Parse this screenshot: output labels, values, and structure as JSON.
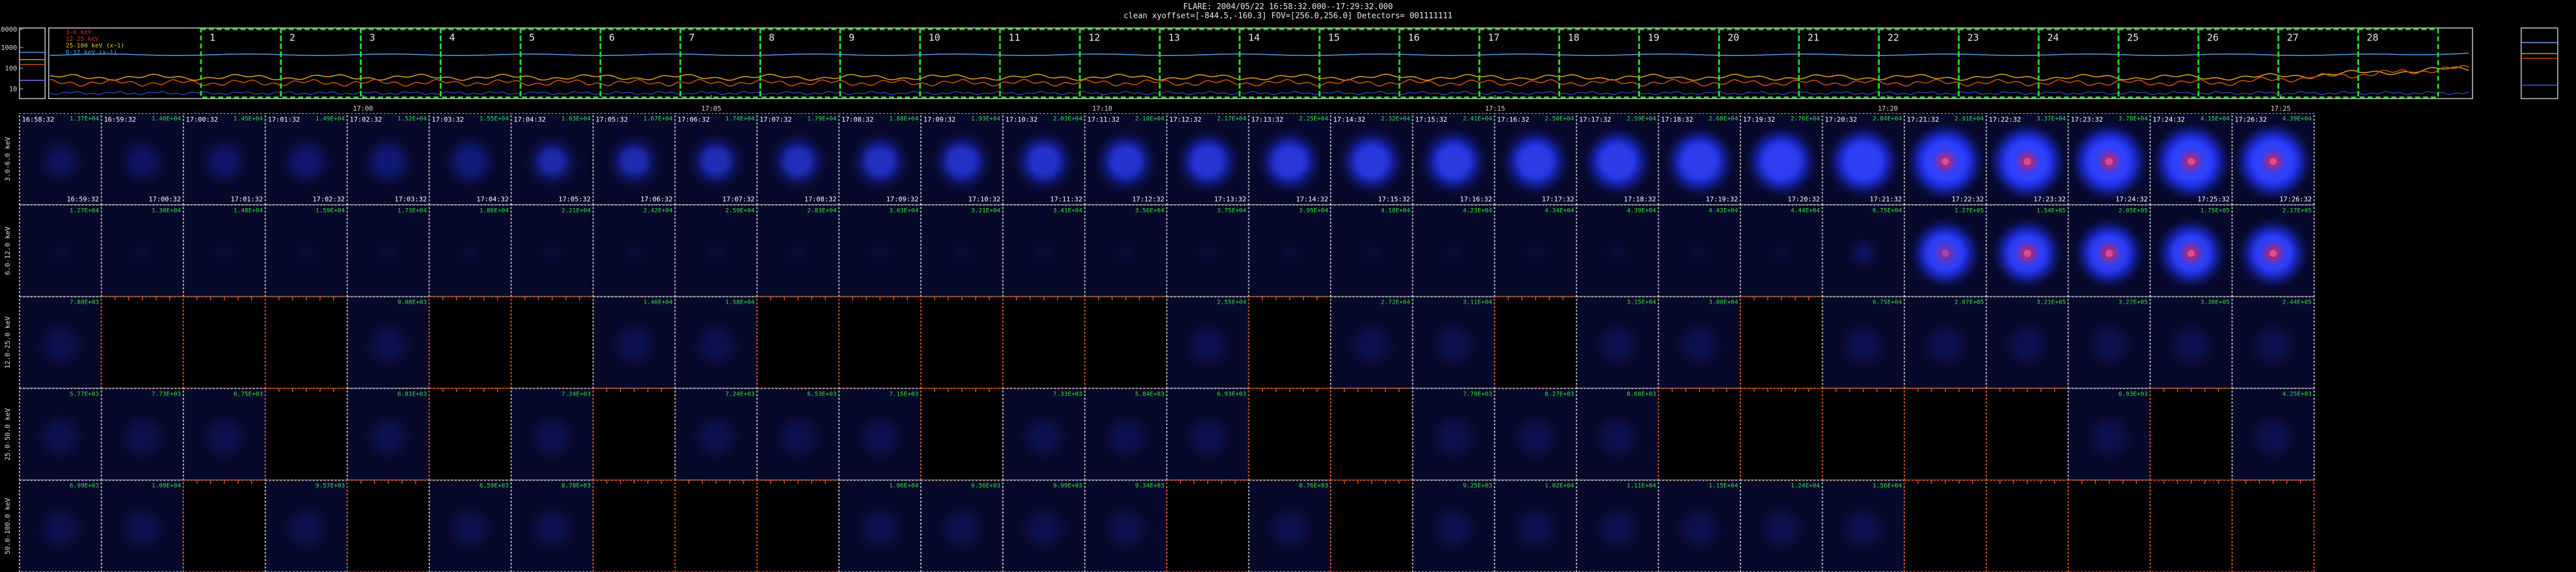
{
  "header": {
    "line1": "FLARE: 2004/05/22  16:58:32.000--17:29:32.000",
    "line2": "clean    xyoffset=[-844.5,-160.3]    FOV=[256.0,256.0]    Detectors= 001111111"
  },
  "timeline": {
    "yticks": [
      "10000",
      "1000",
      "100",
      "10"
    ],
    "legend": [
      "3-6 keV",
      "12-25 keV",
      "25-100 keV (x~1)",
      "6-12 keV (x~1)"
    ],
    "box_numbers": [
      "1",
      "2",
      "3",
      "4",
      "5",
      "6",
      "7",
      "8",
      "9",
      "10",
      "11",
      "12",
      "13",
      "14",
      "15",
      "16",
      "17",
      "18",
      "19",
      "20",
      "21",
      "22",
      "23",
      "24",
      "25",
      "26",
      "27",
      "28"
    ],
    "time_ticks": [
      "17:00",
      "17:05",
      "17:10",
      "17:15",
      "17:20",
      "17:25"
    ],
    "colors": {
      "series_a": "#4f9ce6",
      "series_b": "#e0a020",
      "series_c": "#d05010",
      "selection_boxes": "#28d828",
      "axes": "#cfcfcf"
    }
  },
  "grid": {
    "energy_bands": [
      "3.0-6.0 keV",
      "6.0-12.0 keV",
      "12.0-25.0 keV",
      "25.0-50.0 keV",
      "50.0-100.0 keV"
    ],
    "start_times": [
      "16:58:32",
      "16:59:32",
      "17:00:32",
      "17:01:32",
      "17:02:32",
      "17:03:32",
      "17:04:32",
      "17:05:32",
      "17:06:32",
      "17:07:32",
      "17:08:32",
      "17:09:32",
      "17:10:32",
      "17:11:32",
      "17:12:32",
      "17:13:32",
      "17:14:32",
      "17:15:32",
      "17:16:32",
      "17:17:32",
      "17:18:32",
      "17:19:32",
      "17:20:32",
      "17:21:32",
      "17:22:32",
      "17:23:32",
      "17:24:32",
      "17:26:32"
    ],
    "end_times": [
      "16:59:32",
      "17:00:32",
      "17:01:32",
      "17:02:32",
      "17:03:32",
      "17:04:32",
      "17:05:32",
      "17:06:32",
      "17:07:32",
      "17:08:32",
      "17:09:32",
      "17:10:32",
      "17:11:32",
      "17:12:32",
      "17:13:32",
      "17:14:32",
      "17:15:32",
      "17:16:32",
      "17:17:32",
      "17:18:32",
      "17:19:32",
      "17:20:32",
      "17:21:32",
      "17:22:32",
      "17:23:32",
      "17:24:32",
      "17:25:32",
      "17:26:32"
    ],
    "values": [
      [
        "1.37E+04",
        "1.40E+04",
        "1.45E+04",
        "1.49E+04",
        "1.52E+04",
        "1.55E+04",
        "1.63E+04",
        "1.67E+04",
        "1.74E+04",
        "1.79E+04",
        "1.88E+04",
        "1.93E+04",
        "2.03E+04",
        "2.10E+04",
        "2.17E+04",
        "2.25E+04",
        "2.32E+04",
        "2.41E+04",
        "2.50E+04",
        "2.59E+04",
        "2.68E+04",
        "2.76E+04",
        "2.84E+04",
        "2.91E+04",
        "3.37E+04",
        "3.78E+04",
        "4.15E+04",
        "4.39E+04"
      ],
      [
        "1.27E+04",
        "1.30E+04",
        "1.48E+04",
        "1.59E+04",
        "1.73E+04",
        "1.86E+04",
        "2.21E+04",
        "2.42E+04",
        "2.59E+04",
        "2.83E+04",
        "3.03E+04",
        "3.21E+04",
        "3.41E+04",
        "3.56E+04",
        "3.75E+04",
        "3.95E+04",
        "4.10E+04",
        "4.23E+04",
        "4.34E+04",
        "4.39E+04",
        "4.42E+04",
        "4.44E+04",
        "6.75E+04",
        "1.27E+05",
        "1.54E+05",
        "2.05E+05",
        "1.75E+05",
        "2.17E+05"
      ],
      [
        "7.80E+03",
        "",
        "",
        "",
        "9.08E+03",
        "",
        "",
        "1.46E+04",
        "1.58E+04",
        "",
        "",
        "",
        "",
        "",
        "2.55E+04",
        "",
        "2.72E+04",
        "3.11E+04",
        "",
        "3.15E+04",
        "3.00E+04",
        "",
        "6.75E+04",
        "2.07E+05",
        "3.21E+05",
        "3.27E+05",
        "3.30E+05",
        "2.44E+05"
      ],
      [
        "5.77E+03",
        "7.73E+03",
        "6.75E+03",
        "",
        "6.81E+03",
        "",
        "7.24E+03",
        "",
        "7.24E+03",
        "6.53E+03",
        "7.15E+03",
        "",
        "7.33E+03",
        "5.84E+03",
        "6.93E+03",
        "",
        "",
        "7.79E+03",
        "8.27E+03",
        "8.68E+03",
        "",
        "",
        "",
        "",
        "",
        "6.93E+03",
        "",
        "4.25E+03"
      ],
      [
        "6.99E+03",
        "1.09E+04",
        "",
        "9.57E+03",
        "",
        "6.59E+03",
        "8.78E+03",
        "",
        "",
        "",
        "1.06E+04",
        "9.56E+03",
        "9.99E+03",
        "9.34E+03",
        "",
        "8.76E+03",
        "",
        "9.25E+03",
        "1.02E+04",
        "1.11E+04",
        "1.15E+04",
        "1.24E+04",
        "1.56E+04",
        "",
        "",
        "",
        "",
        ""
      ]
    ],
    "colors": {
      "value_text": "#34e034",
      "time_text": "#ffffff",
      "cell_border": "#bdbdbd",
      "empty_border": "#d85a20",
      "blob": "#2236ff",
      "core": "#d02050"
    }
  }
}
